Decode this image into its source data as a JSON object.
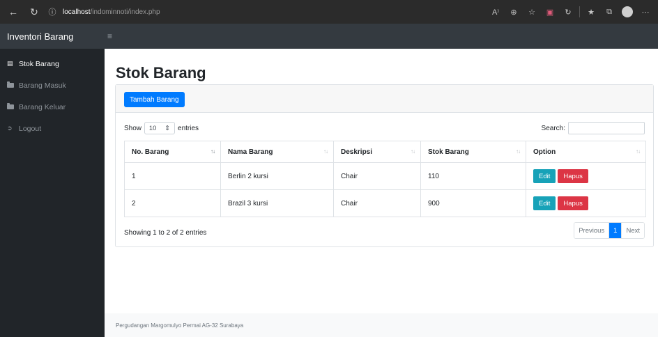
{
  "browser": {
    "url_host": "localhost",
    "url_path": "/indominnoti/index.php",
    "icons": [
      "back-arrow-icon",
      "refresh-icon",
      "info-icon",
      "read-aloud-icon",
      "zoom-icon",
      "favorite-icon",
      "pocket-icon",
      "copilot-icon",
      "favorites-bar-icon",
      "collections-icon",
      "profile-icon",
      "more-icon"
    ]
  },
  "app": {
    "brand": "Inventori Barang",
    "menu_toggle_glyph": "≡"
  },
  "sidebar": {
    "items": [
      {
        "label": "Stok Barang",
        "icon": "table-icon",
        "active": true
      },
      {
        "label": "Barang Masuk",
        "icon": "folder-icon",
        "active": false
      },
      {
        "label": "Barang Keluar",
        "icon": "folder-icon",
        "active": false
      },
      {
        "label": "Logout",
        "icon": "logout-icon",
        "active": false
      }
    ]
  },
  "main": {
    "title": "Stok Barang",
    "add_button": "Tambah Barang",
    "show_label": "Show",
    "entries_value": "10",
    "entries_label": "entries",
    "search_label": "Search:",
    "search_value": "",
    "table": {
      "headers": [
        "No. Barang",
        "Nama Barang",
        "Deskripsi",
        "Stok Barang",
        "Option"
      ],
      "rows": [
        [
          "1",
          "Berlin 2 kursi",
          "Chair",
          "110"
        ],
        [
          "2",
          "Brazil 3 kursi",
          "Chair",
          "900"
        ]
      ],
      "edit_label": "Edit",
      "delete_label": "Hapus"
    },
    "info": "Showing 1 to 2 of 2 entries",
    "pagination": {
      "previous": "Previous",
      "current": "1",
      "next": "Next"
    },
    "footer": "Pergudangan Margomulyo Permai AG-32 Surabaya"
  },
  "colors": {
    "primary": "#007bff",
    "info": "#17a2b8",
    "danger": "#dc3545",
    "sidebar_bg": "#212529",
    "topbar_bg": "#343a40"
  }
}
